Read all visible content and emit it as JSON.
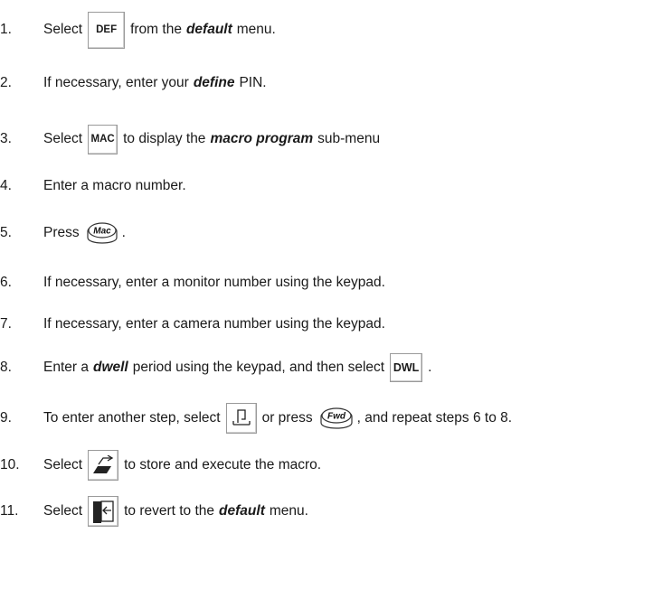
{
  "steps": [
    {
      "num": "1.",
      "t1": "Select",
      "key": "DEF",
      "t2": "from the",
      "em": "default",
      "t3": "menu."
    },
    {
      "num": "2.",
      "t1": "If necessary, enter your",
      "em": "define",
      "t2": "PIN."
    },
    {
      "num": "3.",
      "t1": "Select",
      "key": "MAC",
      "t2": "to display the",
      "em": "macro program",
      "t3": "sub-menu"
    },
    {
      "num": "4.",
      "t1": "Enter a macro number."
    },
    {
      "num": "5.",
      "t1": "Press",
      "key": "Mac",
      "t2": "."
    },
    {
      "num": "6.",
      "t1": "If necessary, enter a monitor number using the keypad."
    },
    {
      "num": "7.",
      "t1": "If necessary, enter a camera number using the keypad."
    },
    {
      "num": "8.",
      "t1": "Enter a",
      "em": "dwell",
      "t2": "period using the keypad, and then select",
      "key": "DWL",
      "t3": "."
    },
    {
      "num": "9.",
      "t1": "To enter another step, select",
      "t2": "or  press",
      "key": "Fwd",
      "t3": ", and repeat steps 6 to 8."
    },
    {
      "num": "10.",
      "t1": "Select",
      "t2": "to store and execute the macro."
    },
    {
      "num": "11.",
      "t1": "Select",
      "t2": "to revert to the",
      "em": "default",
      "t3": "menu."
    }
  ],
  "icons": {
    "step9_softkey": "new-step-icon",
    "step10_softkey": "store-execute-icon",
    "step11_softkey": "exit-icon"
  }
}
